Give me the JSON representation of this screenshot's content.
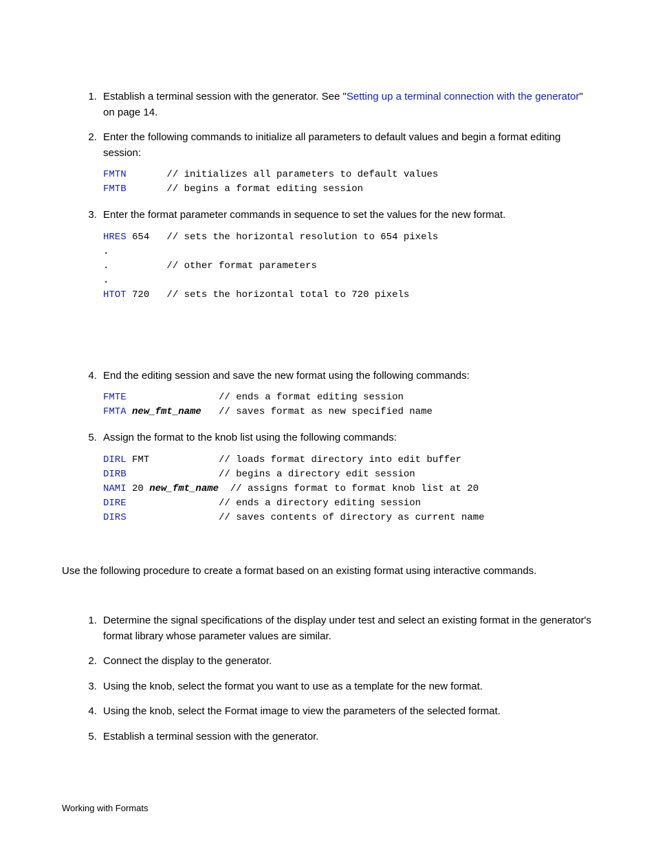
{
  "steps1": {
    "item1_a": "Establish a terminal session with the generator. See \"",
    "item1_link": "Setting up a terminal connection with the generator",
    "item1_b": "\" on page 14.",
    "item2": "Enter the following commands to initialize all parameters to default values and begin a format editing session:",
    "code2": {
      "l1_kw": "FMTN",
      "l1_rest": "       // initializes all parameters to default values",
      "l2_kw": "FMTB",
      "l2_rest": "       // begins a format editing session"
    },
    "item3": "Enter the format parameter commands in sequence to set the values for the new format.",
    "code3": {
      "l1_kw": "HRES",
      "l1_rest": " 654   // sets the horizontal resolution to 654 pixels",
      "l2": ".",
      "l3": ".          // other format parameters",
      "l4": ".",
      "l5_kw": "HTOT",
      "l5_rest": " 720   // sets the horizontal total to 720 pixels"
    },
    "item4": "End the editing session and save the new format using the following commands:",
    "code4": {
      "l1_kw": "FMTE",
      "l1_rest": "                // ends a format editing session",
      "l2_kw": "FMTA",
      "l2_var": " new_fmt_name",
      "l2_rest": "   // saves format as new specified name"
    },
    "item5": "Assign the format to the knob list using the following commands:",
    "code5": {
      "l1_kw": "DIRL",
      "l1_rest": " FMT            // loads format directory into edit buffer",
      "l2_kw": "DIRB",
      "l2_rest": "                // begins a directory edit session",
      "l3_kw": "NAMI",
      "l3_mid": " 20 ",
      "l3_var": "new_fmt_name",
      "l3_rest": "  // assigns format to format knob list at 20",
      "l4_kw": "DIRE",
      "l4_rest": "                // ends a directory editing session",
      "l5_kw": "DIRS",
      "l5_rest": "                // saves contents of directory as current name"
    }
  },
  "intro2": "Use the following procedure to create a format based on an existing format using interactive commands.",
  "steps2": {
    "item1": "Determine the signal specifications of the display under test and select an existing format in the generator's format library whose parameter values are similar.",
    "item2": "Connect the display to the generator.",
    "item3": "Using the          knob, select the format you want to use as a template for the new format.",
    "item4": "Using the          knob, select the Format image to view the parameters of the selected format.",
    "item5": "Establish a terminal session with the generator."
  },
  "footer": "Working with Formats"
}
